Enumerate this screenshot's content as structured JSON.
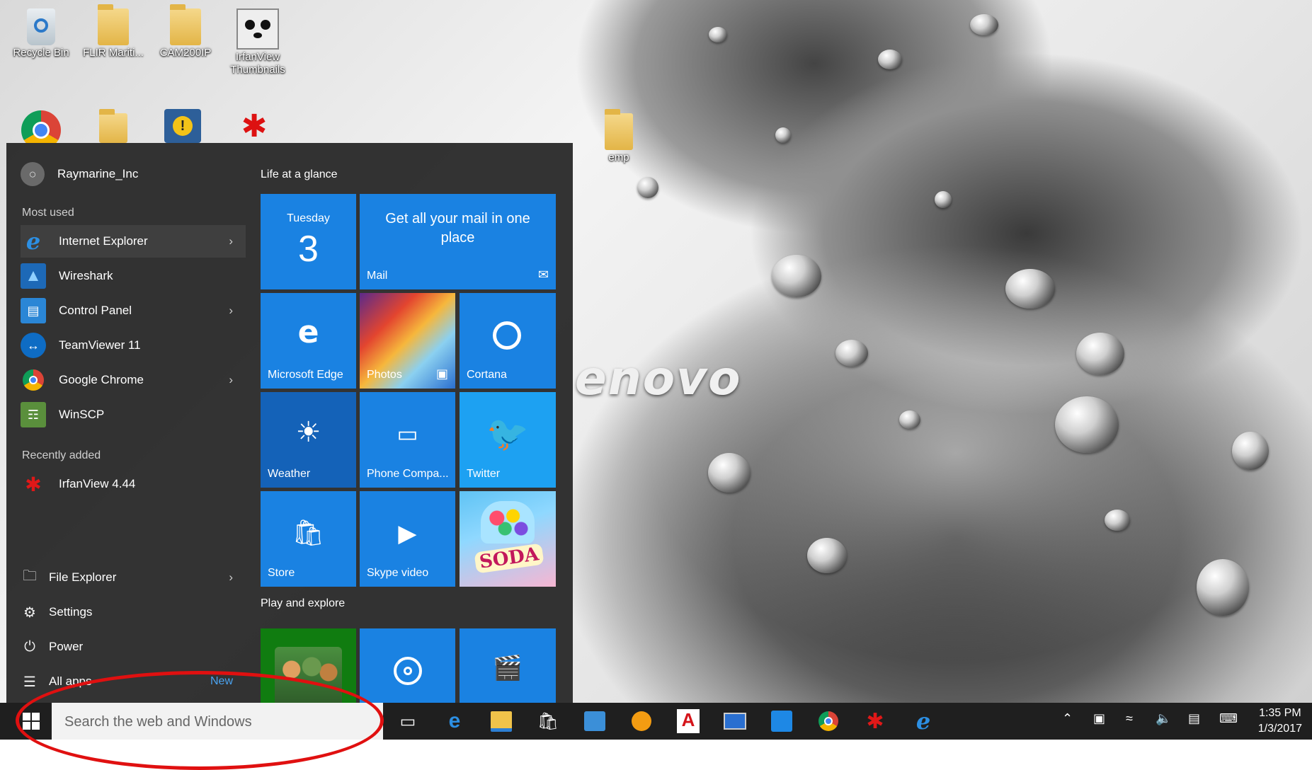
{
  "desktop": {
    "brand_text": "enovo",
    "icons": [
      {
        "label": "Recycle Bin",
        "icon": "recycle-bin-icon"
      },
      {
        "label": "FLIR Mariti...",
        "icon": "folder-icon"
      },
      {
        "label": "CAM200IP",
        "icon": "folder-icon"
      },
      {
        "label": "IrfanView Thumbnails",
        "icon": "panda-icon"
      },
      {
        "label": "emp",
        "icon": "folder-icon"
      }
    ]
  },
  "start_menu": {
    "user_name": "Raymarine_Inc",
    "most_used_header": "Most used",
    "most_used": [
      {
        "label": "Internet Explorer",
        "icon": "internet-explorer-icon",
        "has_arrow": true
      },
      {
        "label": "Wireshark",
        "icon": "wireshark-icon",
        "has_arrow": false
      },
      {
        "label": "Control Panel",
        "icon": "control-panel-icon",
        "has_arrow": true
      },
      {
        "label": "TeamViewer 11",
        "icon": "teamviewer-icon",
        "has_arrow": false
      },
      {
        "label": "Google Chrome",
        "icon": "chrome-icon",
        "has_arrow": true
      },
      {
        "label": "WinSCP",
        "icon": "winscp-icon",
        "has_arrow": false
      }
    ],
    "recently_added_header": "Recently added",
    "recently_added": [
      {
        "label": "IrfanView 4.44",
        "icon": "irfanview-icon"
      }
    ],
    "system": {
      "file_explorer": "File Explorer",
      "settings": "Settings",
      "power": "Power",
      "all_apps": "All apps",
      "new_badge": "New"
    },
    "groups": {
      "life": "Life at a glance",
      "play": "Play and explore"
    },
    "tiles": {
      "calendar_day": "Tuesday",
      "calendar_date": "3",
      "mail_message": "Get all your mail in one place",
      "mail": "Mail",
      "edge": "Microsoft Edge",
      "photos": "Photos",
      "cortana": "Cortana",
      "weather": "Weather",
      "phone": "Phone Compa...",
      "twitter": "Twitter",
      "store": "Store",
      "skype": "Skype video",
      "candy": "SODA"
    }
  },
  "taskbar": {
    "search_placeholder": "Search the web and Windows",
    "time": "1:35 PM",
    "date": "1/3/2017"
  },
  "colors": {
    "tile_blue": "#1a82e2",
    "start_bg": "#262626",
    "annotation_red": "#e01010"
  }
}
